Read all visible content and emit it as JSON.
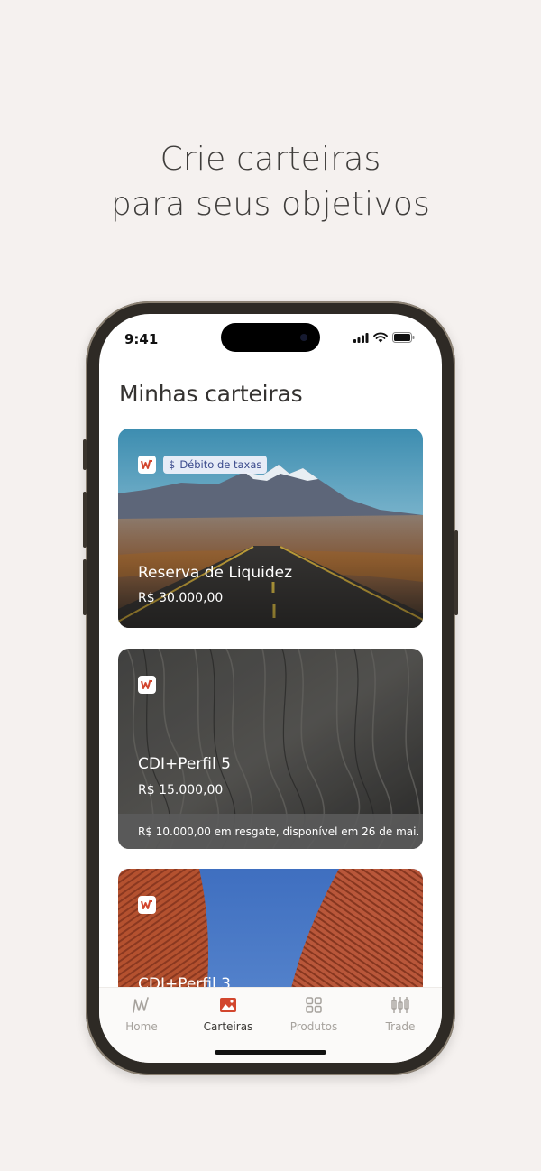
{
  "headline": {
    "line1": "Crie carteiras",
    "line2": "para seus objetivos"
  },
  "status_bar": {
    "time": "9:41",
    "icons": [
      "signal-icon",
      "wifi-icon",
      "battery-icon"
    ]
  },
  "page": {
    "title": "Minhas carteiras"
  },
  "cards": [
    {
      "name": "Reserva de Liquidez",
      "value": "R$ 30.000,00",
      "badge": "Débito de taxas",
      "badge_icon": "$",
      "image": "mountain-road"
    },
    {
      "name": "CDI+Perfil 5",
      "value": "R$ 15.000,00",
      "note": "R$ 10.000,00 em resgate, disponível em 26 de mai.",
      "image": "eroded-rock"
    },
    {
      "name": "CDI+Perfil 3",
      "image": "red-buildings"
    }
  ],
  "tabbar": {
    "tabs": [
      {
        "label": "Home",
        "icon": "home-chart-icon",
        "active": false
      },
      {
        "label": "Carteiras",
        "icon": "image-icon",
        "active": true
      },
      {
        "label": "Produtos",
        "icon": "grid-icon",
        "active": false
      },
      {
        "label": "Trade",
        "icon": "candlestick-icon",
        "active": false
      }
    ]
  },
  "colors": {
    "background": "#f5f1ef",
    "brand_red": "#d2462e",
    "tab_inactive": "#a6a29d",
    "tab_active": "#3a3835"
  }
}
